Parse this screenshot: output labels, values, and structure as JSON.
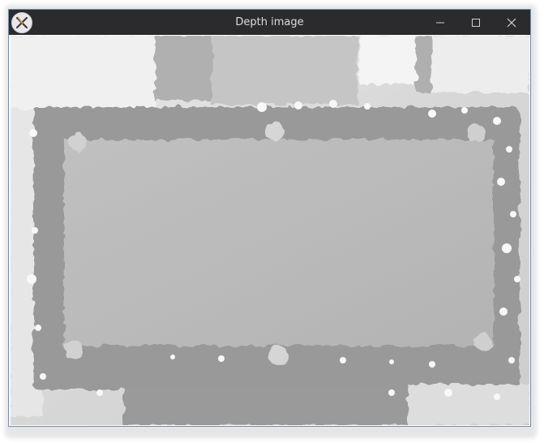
{
  "window": {
    "title": "Depth image",
    "app_icon": "qt-icon",
    "controls": [
      "minimize-icon",
      "maximize-icon",
      "close-icon"
    ]
  }
}
